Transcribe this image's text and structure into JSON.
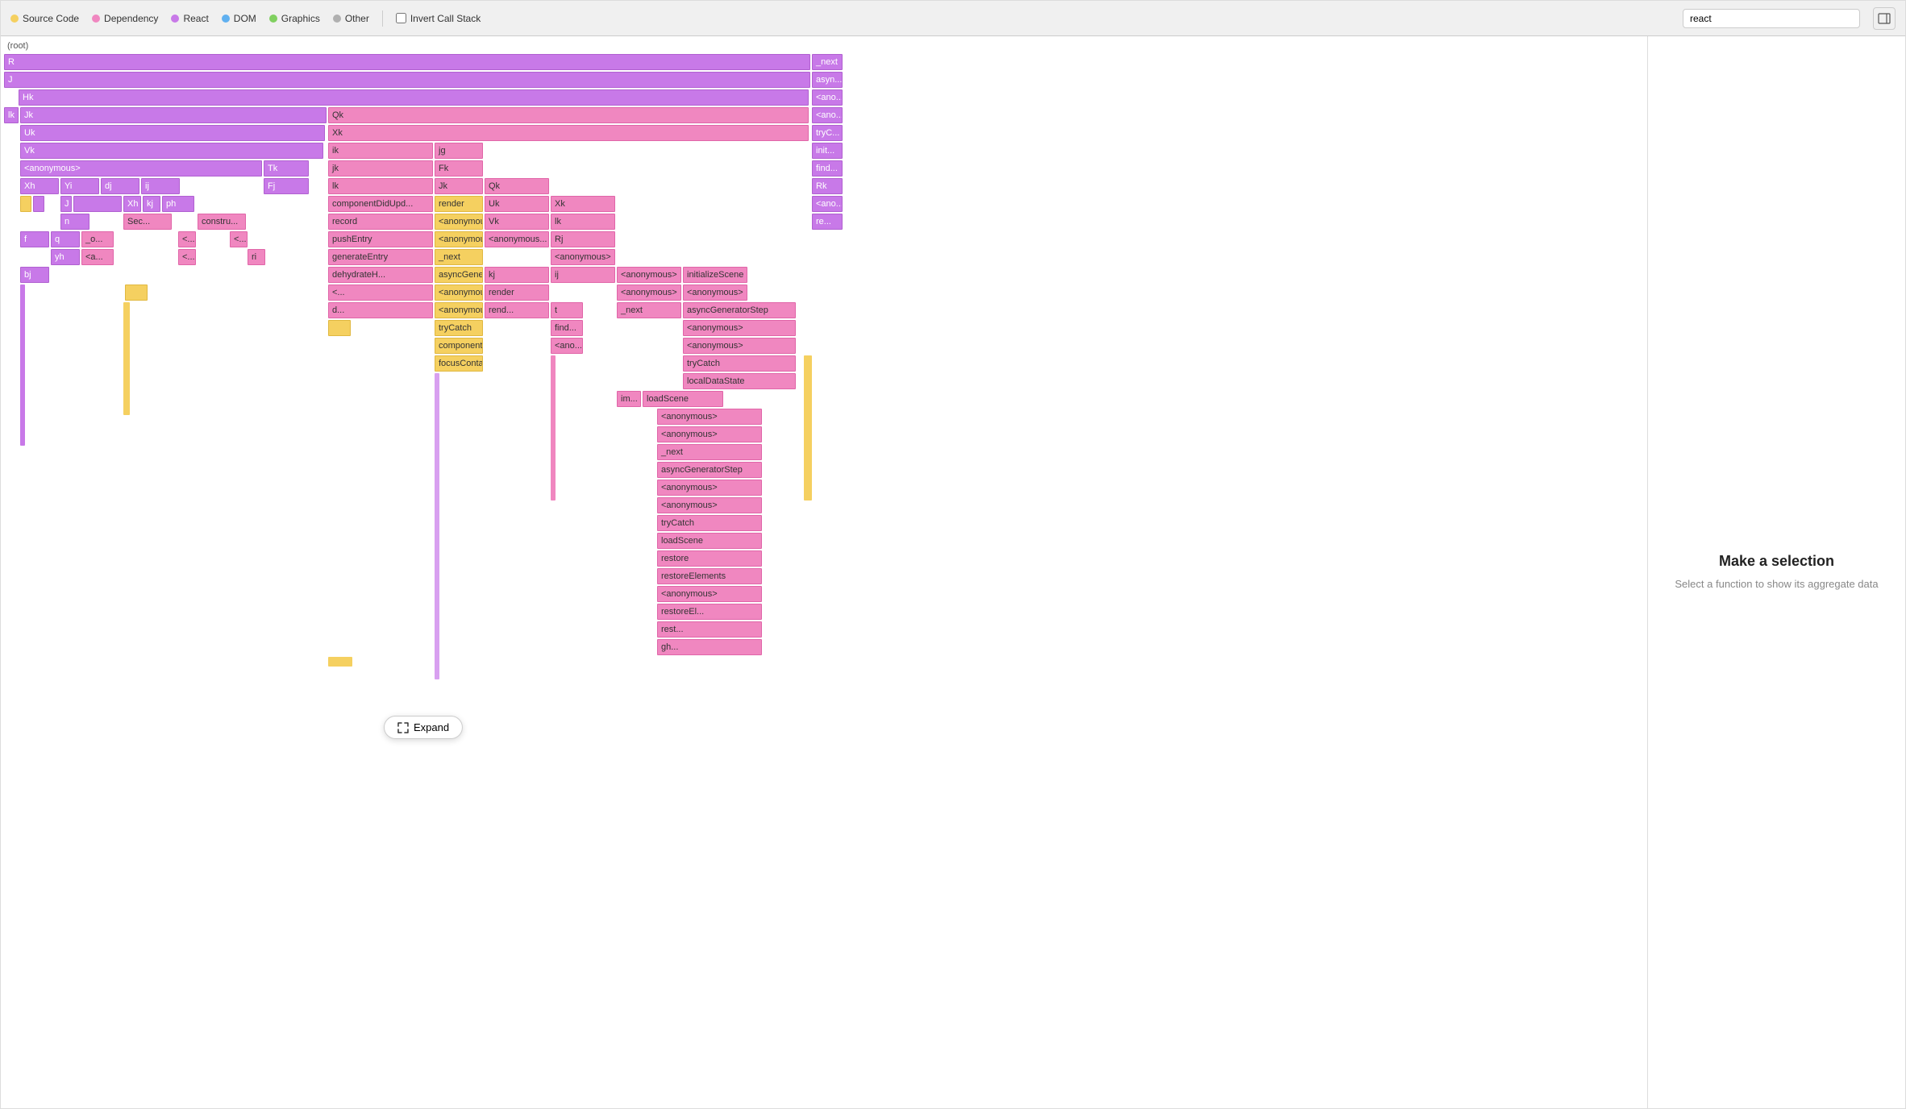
{
  "toolbar": {
    "legend": [
      {
        "label": "Source Code",
        "color": "#f5d060",
        "dot_color": "#f5d060"
      },
      {
        "label": "Dependency",
        "color": "#f087c0",
        "dot_color": "#f087c0"
      },
      {
        "label": "React",
        "color": "#c879e8",
        "dot_color": "#c879e8"
      },
      {
        "label": "DOM",
        "color": "#60b0f0",
        "dot_color": "#60b0f0"
      },
      {
        "label": "Graphics",
        "color": "#80d060",
        "dot_color": "#80d060"
      },
      {
        "label": "Other",
        "color": "#b0b0b0",
        "dot_color": "#b0b0b0"
      }
    ],
    "invert_label": "Invert Call Stack",
    "search_placeholder": "react",
    "search_value": "react",
    "expand_label": "Expand"
  },
  "right_panel": {
    "title": "Make a selection",
    "description": "Select a function to show its aggregate data"
  },
  "root_label": "(root)",
  "flamegraph": {
    "rows": []
  }
}
